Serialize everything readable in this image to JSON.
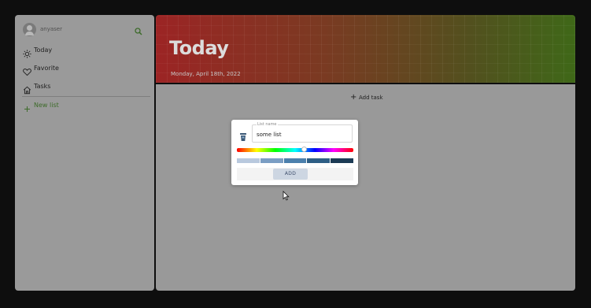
{
  "sidebar": {
    "username": "anyaser",
    "items": [
      {
        "label": "Today",
        "icon": "sun-icon"
      },
      {
        "label": "Favorite",
        "icon": "heart-icon"
      },
      {
        "label": "Tasks",
        "icon": "home-icon"
      }
    ],
    "new_list_label": "New list",
    "search_icon": "search-icon"
  },
  "header": {
    "title": "Today",
    "date": "Monday, April 18th, 2022"
  },
  "main": {
    "add_task_label": "Add task"
  },
  "new_list_dialog": {
    "field_label": "List name",
    "field_value": "some list",
    "hue_fraction": 0.58,
    "swatches": [
      "#b9c9de",
      "#7b9ec4",
      "#4c80ad",
      "#2e5f86",
      "#1c3b55"
    ],
    "add_button_label": "ADD"
  },
  "colors": {
    "accent": "#3d6b2a",
    "header_gradient_start": "#9c2424",
    "header_gradient_end": "#3f6818"
  }
}
